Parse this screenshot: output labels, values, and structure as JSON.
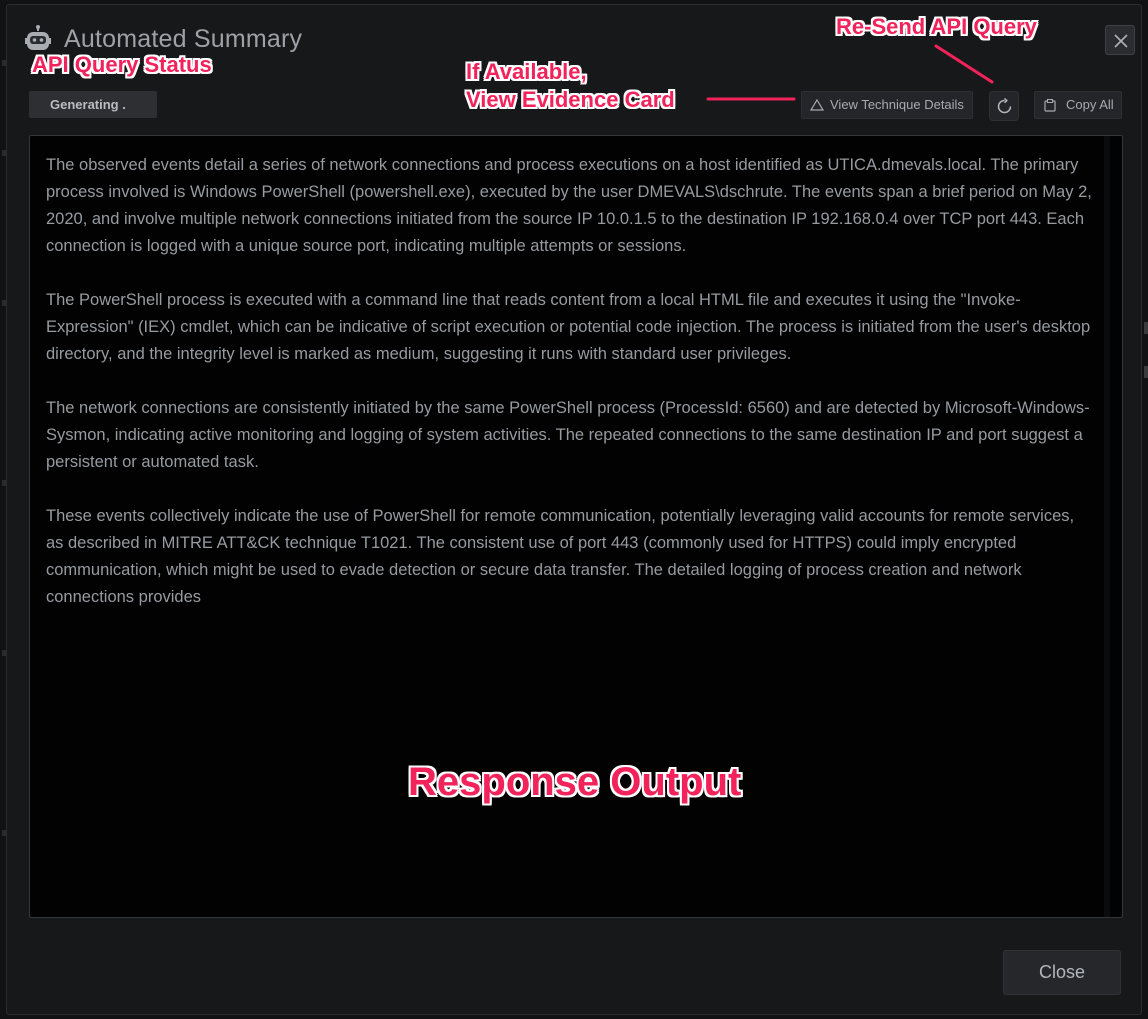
{
  "dialog": {
    "title": "Automated Summary",
    "status": "Generating .",
    "buttons": {
      "view_technique": "View Technique Details",
      "copy_all": "Copy All",
      "close": "Close"
    },
    "icons": {
      "header": "robot-icon",
      "close": "close-icon",
      "technique": "triangle-warning-icon",
      "refresh": "refresh-icon",
      "copy": "clipboard-icon"
    },
    "response_paragraphs": [
      "The observed events detail a series of network connections and process executions on a host identified as UTICA.dmevals.local. The primary process involved is Windows PowerShell (powershell.exe), executed by the user DMEVALS\\dschrute. The events span a brief period on May 2, 2020, and involve multiple network connections initiated from the source IP 10.0.1.5 to the destination IP 192.168.0.4 over TCP port 443. Each connection is logged with a unique source port, indicating multiple attempts or sessions.",
      "The PowerShell process is executed with a command line that reads content from a local HTML file and executes it using the \"Invoke-Expression\" (IEX) cmdlet, which can be indicative of script execution or potential code injection. The process is initiated from the user's desktop directory, and the integrity level is marked as medium, suggesting it runs with standard user privileges.",
      "The network connections are consistently initiated by the same PowerShell process (ProcessId: 6560) and are detected by Microsoft-Windows-Sysmon, indicating active monitoring and logging of system activities. The repeated connections to the same destination IP and port suggest a persistent or automated task.",
      "These events collectively indicate the use of PowerShell for remote communication, potentially leveraging valid accounts for remote services, as described in MITRE ATT&CK technique T1021. The consistent use of port 443 (commonly used for HTTPS) could imply encrypted communication, which might be used to evade detection or secure data transfer. The detailed logging of process creation and network connections provides"
    ]
  },
  "annotations": {
    "api_status": "API Query Status",
    "resend": "Re-Send API Query",
    "evidence_line1": "If Available,",
    "evidence_line2": "View Evidence Card",
    "output": "Response Output"
  },
  "colors": {
    "annotation": "#f2225a",
    "dialog_bg": "#17181a",
    "response_bg": "#020203"
  }
}
